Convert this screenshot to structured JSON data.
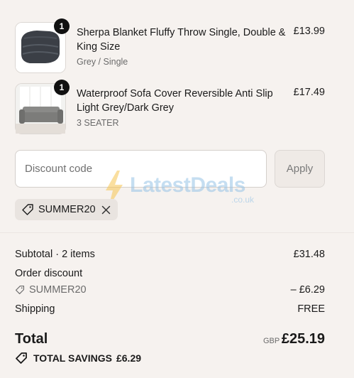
{
  "cart": {
    "items": [
      {
        "title": "Sherpa Blanket Fluffy Throw Single, Double & King Size",
        "variant": "Grey / Single",
        "price": "£13.99",
        "quantity": "1",
        "image": "folded-grey-blanket"
      },
      {
        "title": "Waterproof Sofa Cover Reversible Anti Slip Light Grey/Dark Grey",
        "variant": "3 SEATER",
        "price": "£17.49",
        "quantity": "1",
        "image": "grey-sofa-in-room"
      }
    ]
  },
  "discount": {
    "placeholder": "Discount code",
    "apply_label": "Apply",
    "applied_code": "SUMMER20"
  },
  "watermark": {
    "text": "LatestDeals",
    "subtext": ".co.uk"
  },
  "summary": {
    "subtotal_label": "Subtotal · 2 items",
    "subtotal_value": "£31.48",
    "order_discount_label": "Order discount",
    "discount_code": "SUMMER20",
    "discount_value": "– £6.29",
    "shipping_label": "Shipping",
    "shipping_value": "FREE",
    "total_label": "Total",
    "currency": "GBP",
    "total_value": "£25.19",
    "savings_label": "TOTAL SAVINGS",
    "savings_value": "£6.29"
  },
  "colors": {
    "background": "#f6f2ef",
    "text": "#1a1a1a",
    "muted": "#6b6b6b",
    "badge": "#111111"
  }
}
